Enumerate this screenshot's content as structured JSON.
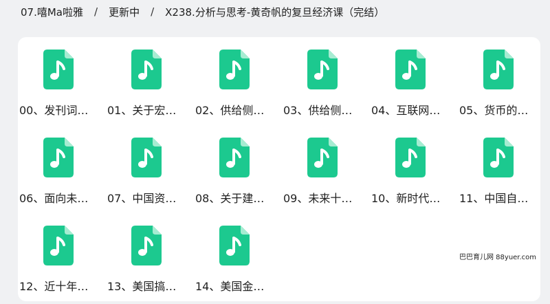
{
  "breadcrumb": {
    "items": [
      "07.嘻Ma啦雅",
      "更新中",
      "X238.分析与思考-黄奇帆的复旦经济课（完结）"
    ],
    "separator": "/"
  },
  "theme": {
    "icon_color": "#1cc98f",
    "icon_fold_color": "#a6ecd2",
    "icon_glyph_color": "#ffffff"
  },
  "files": [
    {
      "name": "00、发刊词…",
      "icon": "audio-file-icon"
    },
    {
      "name": "01、关于宏…",
      "icon": "audio-file-icon"
    },
    {
      "name": "02、供给侧…",
      "icon": "audio-file-icon"
    },
    {
      "name": "03、供给侧…",
      "icon": "audio-file-icon"
    },
    {
      "name": "04、互联网…",
      "icon": "audio-file-icon"
    },
    {
      "name": "05、货币的…",
      "icon": "audio-file-icon"
    },
    {
      "name": "06、面向未…",
      "icon": "audio-file-icon"
    },
    {
      "name": "07、中国资…",
      "icon": "audio-file-icon"
    },
    {
      "name": "08、关于建…",
      "icon": "audio-file-icon"
    },
    {
      "name": "09、未来十…",
      "icon": "audio-file-icon"
    },
    {
      "name": "10、新时代…",
      "icon": "audio-file-icon"
    },
    {
      "name": "11、中国自…",
      "icon": "audio-file-icon"
    },
    {
      "name": "12、近十年…",
      "icon": "audio-file-icon"
    },
    {
      "name": "13、美国搞…",
      "icon": "audio-file-icon"
    },
    {
      "name": "14、美国金…",
      "icon": "audio-file-icon"
    }
  ],
  "watermark": "巴巴育儿网 88yuer.com"
}
